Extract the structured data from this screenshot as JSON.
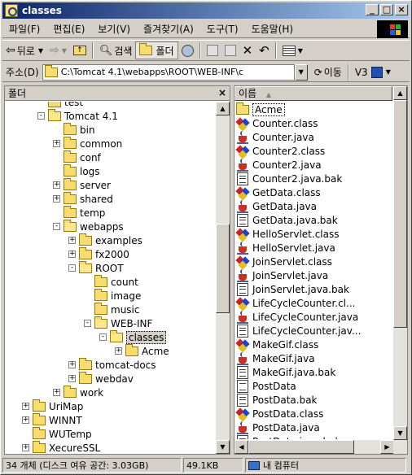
{
  "window": {
    "title": "classes",
    "min": "_",
    "max": "□",
    "close": "×"
  },
  "menu": [
    {
      "label": "파일(F)",
      "name": "menu-file"
    },
    {
      "label": "편집(E)",
      "name": "menu-edit"
    },
    {
      "label": "보기(V)",
      "name": "menu-view"
    },
    {
      "label": "즐겨찾기(A)",
      "name": "menu-favorites"
    },
    {
      "label": "도구(T)",
      "name": "menu-tools"
    },
    {
      "label": "도움말(H)",
      "name": "menu-help"
    }
  ],
  "toolbar": {
    "back_label": "뒤로",
    "search_label": "검색",
    "folders_label": "폴더"
  },
  "address": {
    "label": "주소(D)",
    "value": "C:\\Tomcat 4.1\\webapps\\ROOT\\WEB-INF\\c",
    "go_label": "이동",
    "v3_label": "V3"
  },
  "left_pane": {
    "title": "폴더",
    "close": "×",
    "tree": [
      {
        "label": "test",
        "depth": 1,
        "exp": "",
        "open": false
      },
      {
        "label": "Tomcat 4.1",
        "depth": 1,
        "exp": "-",
        "open": true
      },
      {
        "label": "bin",
        "depth": 2,
        "exp": "",
        "open": false
      },
      {
        "label": "common",
        "depth": 2,
        "exp": "+",
        "open": false
      },
      {
        "label": "conf",
        "depth": 2,
        "exp": "",
        "open": false
      },
      {
        "label": "logs",
        "depth": 2,
        "exp": "",
        "open": false
      },
      {
        "label": "server",
        "depth": 2,
        "exp": "+",
        "open": false
      },
      {
        "label": "shared",
        "depth": 2,
        "exp": "+",
        "open": false
      },
      {
        "label": "temp",
        "depth": 2,
        "exp": "",
        "open": false
      },
      {
        "label": "webapps",
        "depth": 2,
        "exp": "-",
        "open": true
      },
      {
        "label": "examples",
        "depth": 3,
        "exp": "+",
        "open": false
      },
      {
        "label": "fx2000",
        "depth": 3,
        "exp": "+",
        "open": false
      },
      {
        "label": "ROOT",
        "depth": 3,
        "exp": "-",
        "open": true
      },
      {
        "label": "count",
        "depth": 4,
        "exp": "",
        "open": false
      },
      {
        "label": "image",
        "depth": 4,
        "exp": "",
        "open": false
      },
      {
        "label": "music",
        "depth": 4,
        "exp": "",
        "open": false
      },
      {
        "label": "WEB-INF",
        "depth": 4,
        "exp": "-",
        "open": true
      },
      {
        "label": "classes",
        "depth": 5,
        "exp": "-",
        "open": true,
        "selected": true
      },
      {
        "label": "Acme",
        "depth": 6,
        "exp": "+",
        "open": false
      },
      {
        "label": "tomcat-docs",
        "depth": 3,
        "exp": "+",
        "open": false
      },
      {
        "label": "webdav",
        "depth": 3,
        "exp": "+",
        "open": false
      },
      {
        "label": "work",
        "depth": 2,
        "exp": "+",
        "open": false
      },
      {
        "label": "UriMap",
        "depth": 0,
        "exp": "+",
        "open": false
      },
      {
        "label": "WINNT",
        "depth": 0,
        "exp": "+",
        "open": false
      },
      {
        "label": "WUTemp",
        "depth": 0,
        "exp": "",
        "open": false
      },
      {
        "label": "XecureSSL",
        "depth": 0,
        "exp": "+",
        "open": false
      }
    ]
  },
  "right_pane": {
    "column_name": "이름",
    "sort_indicator": "▲",
    "files": [
      {
        "name": "Acme",
        "type": "folder",
        "focused": true
      },
      {
        "name": "Counter.class",
        "type": "class"
      },
      {
        "name": "Counter.java",
        "type": "java"
      },
      {
        "name": "Counter2.class",
        "type": "class"
      },
      {
        "name": "Counter2.java",
        "type": "java"
      },
      {
        "name": "Counter2.java.bak",
        "type": "bak"
      },
      {
        "name": "GetData.class",
        "type": "class"
      },
      {
        "name": "GetData.java",
        "type": "java"
      },
      {
        "name": "GetData.java.bak",
        "type": "bak"
      },
      {
        "name": "HelloServlet.class",
        "type": "class"
      },
      {
        "name": "HelloServlet.java",
        "type": "java"
      },
      {
        "name": "JoinServlet.class",
        "type": "class"
      },
      {
        "name": "JoinServlet.java",
        "type": "java"
      },
      {
        "name": "JoinServlet.java.bak",
        "type": "bak"
      },
      {
        "name": "LifeCycleCounter.cl...",
        "type": "class"
      },
      {
        "name": "LifeCycleCounter.java",
        "type": "java"
      },
      {
        "name": "LifeCycleCounter.jav...",
        "type": "bak"
      },
      {
        "name": "MakeGif.class",
        "type": "class"
      },
      {
        "name": "MakeGif.java",
        "type": "java"
      },
      {
        "name": "MakeGif.java.bak",
        "type": "bak"
      },
      {
        "name": "PostData",
        "type": "file"
      },
      {
        "name": "PostData.bak",
        "type": "bak"
      },
      {
        "name": "PostData.class",
        "type": "class"
      },
      {
        "name": "PostData.java",
        "type": "java"
      },
      {
        "name": "PostData.java.bak",
        "type": "bak"
      }
    ]
  },
  "status": {
    "objects": "34 개체 (디스크 여유 공간: 3.03GB)",
    "size": "49.1KB",
    "zone": "내 컴퓨터"
  }
}
